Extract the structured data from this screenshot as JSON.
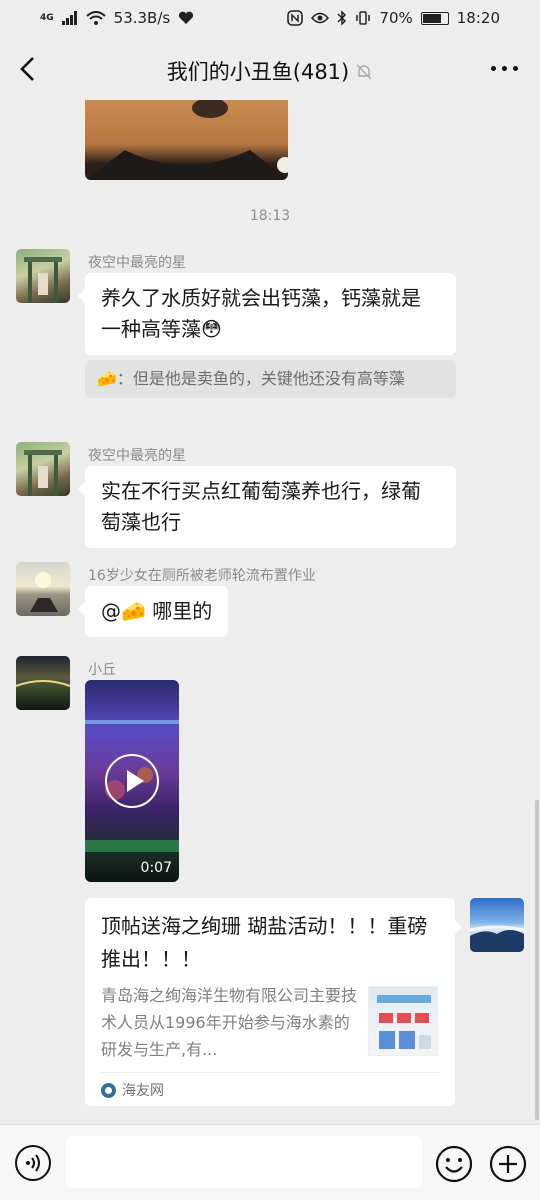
{
  "status_bar": {
    "network_type": "4G",
    "speed": "53.3B/s",
    "battery": "70%",
    "time": "18:20"
  },
  "header": {
    "title": "我们的小丑鱼(481)"
  },
  "chat": {
    "time_label": "18:13",
    "messages": [
      {
        "sender": "夜空中最亮的星",
        "text": "养久了水质好就会出钙藻，钙藻就是一种高等藻😳",
        "quote": "🧀：但是他是卖鱼的，关键他还没有高等藻"
      },
      {
        "sender": "夜空中最亮的星",
        "text": "实在不行买点红葡萄藻养也行，绿葡萄藻也行"
      },
      {
        "sender": "16岁少女在厕所被老师轮流布置作业",
        "text": "@🧀 哪里的"
      },
      {
        "sender": "小丘",
        "video_duration": "0:07"
      }
    ],
    "link_card": {
      "title": "顶帖送海之绚珊 瑚盐活动！！！重磅推出！！！",
      "description": "青岛海之绚海洋生物有限公司主要技术人员从1996年开始参与海水素的研发与生产,有...",
      "source": "海友网"
    }
  },
  "input_bar": {
    "placeholder": ""
  },
  "colors": {
    "background": "#ededed",
    "bubble": "#ffffff",
    "time_text": "#8c8c8c"
  }
}
